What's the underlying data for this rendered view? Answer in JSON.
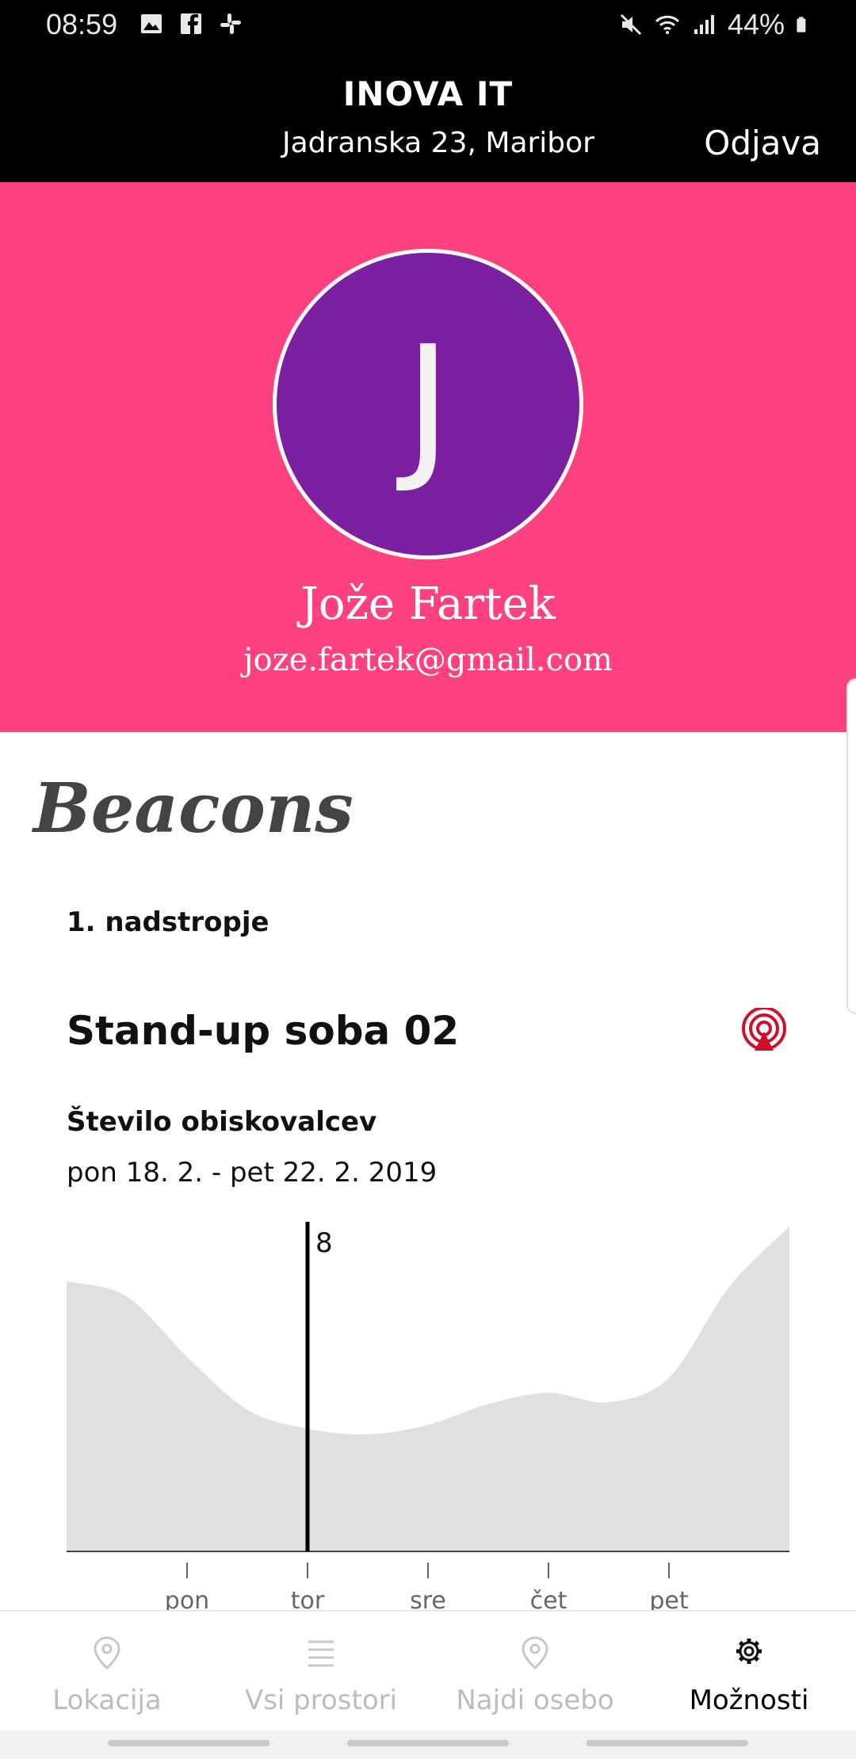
{
  "status_bar": {
    "time": "08:59",
    "battery": "44%",
    "left_icons": [
      "image-icon",
      "facebook-icon",
      "slack-icon"
    ],
    "right_icons": [
      "mute-icon",
      "wifi-icon",
      "signal-icon",
      "battery-icon"
    ]
  },
  "header": {
    "title": "INOVA IT",
    "address": "Jadranska 23, Maribor",
    "logout_label": "Odjava"
  },
  "profile": {
    "initial": "J",
    "name": "Jože Fartek",
    "email": "joze.fartek@gmail.com",
    "background_color": "#ff4180",
    "avatar_color": "#7a20a1"
  },
  "content": {
    "section_title": "Beacons",
    "floor": "1. nadstropje",
    "room": "Stand-up soba 02",
    "visitors_label": "Število obiskovalcev",
    "date_range": "pon 18. 2. - pet 22. 2. 2019",
    "beacon_icon_color": "#d10f2a"
  },
  "chart_data": {
    "type": "area",
    "x": [
      0,
      0.5,
      1,
      1.5,
      2,
      2.5,
      3,
      3.5,
      4,
      4.5,
      5,
      5.5,
      6
    ],
    "values": [
      14.3,
      13.5,
      10.3,
      7.5,
      6.5,
      6.2,
      6.7,
      7.8,
      8.4,
      7.9,
      9.2,
      14.0,
      17.2
    ],
    "categories": [
      "pon",
      "tor",
      "sre",
      "čet",
      "pet"
    ],
    "tick_positions": [
      1,
      2,
      3,
      4,
      5
    ],
    "xlim": [
      0,
      6
    ],
    "ylim": [
      0,
      17.2
    ],
    "marker": {
      "x": 2,
      "label": "8"
    },
    "grid": false,
    "fill_color": "#e0e0e0"
  },
  "bottom_nav": {
    "items": [
      {
        "label": "Lokacija",
        "icon": "location-pin-icon",
        "active": false
      },
      {
        "label": "Vsi prostori",
        "icon": "list-icon",
        "active": false
      },
      {
        "label": "Najdi osebo",
        "icon": "location-pin-icon",
        "active": false
      },
      {
        "label": "Možnosti",
        "icon": "gear-icon",
        "active": true
      }
    ]
  }
}
